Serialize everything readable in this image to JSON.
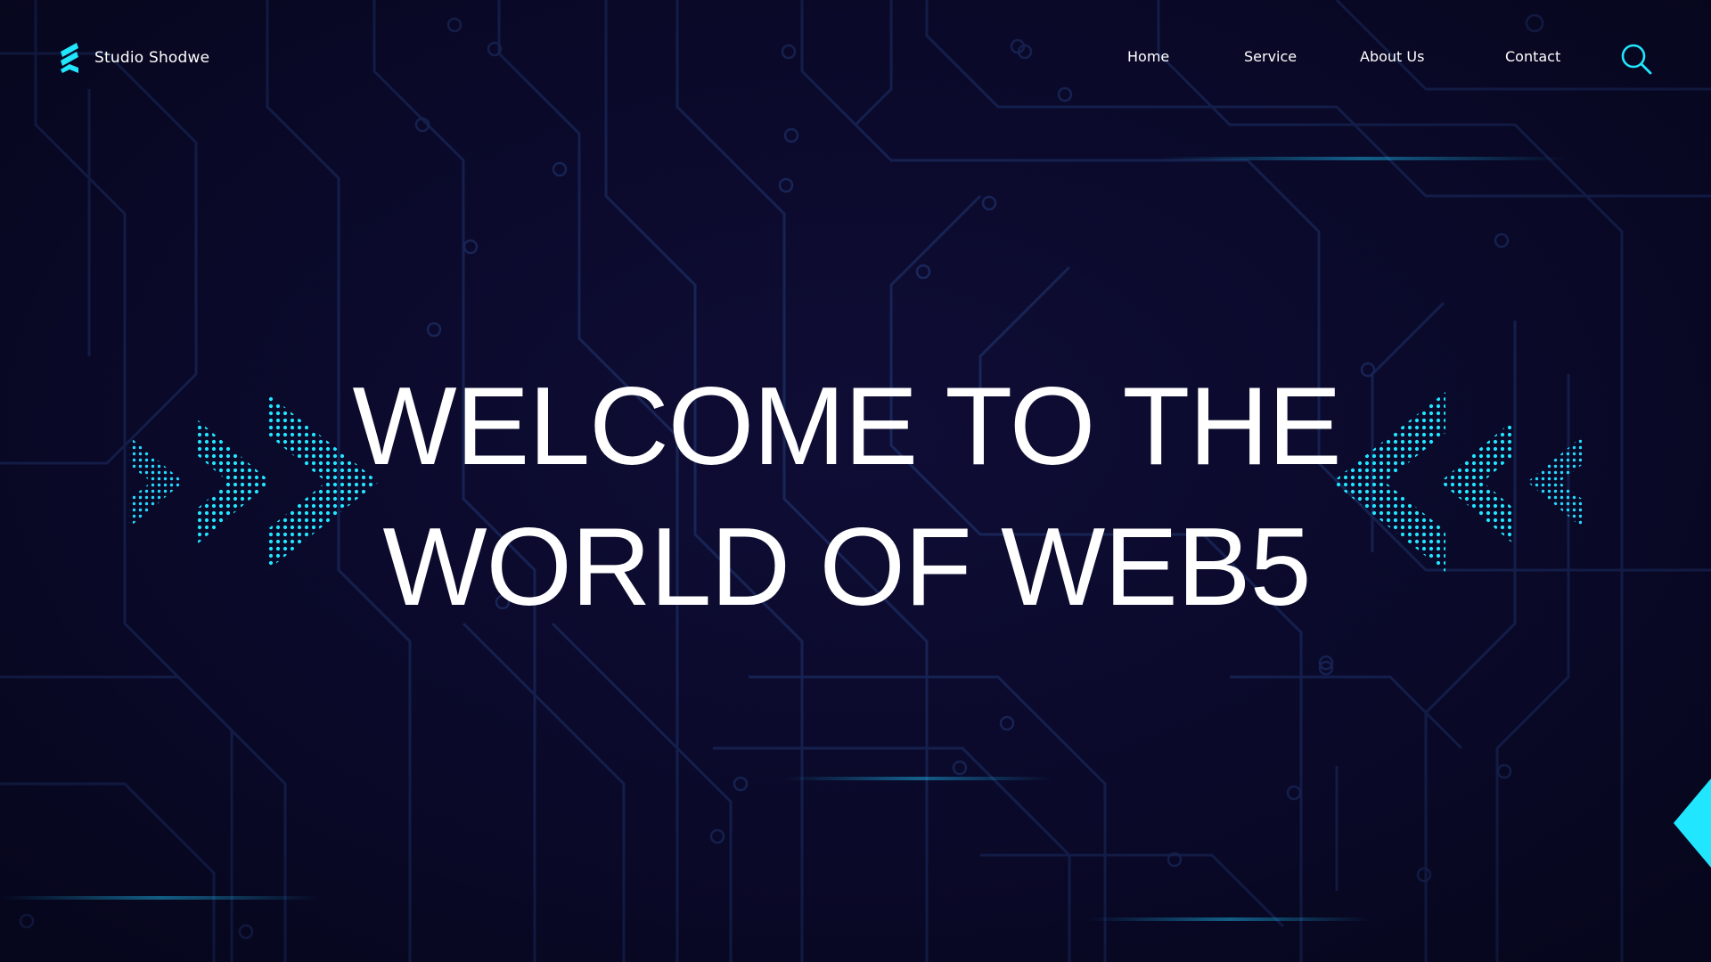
{
  "brand": {
    "name": "Studio Shodwe",
    "logo_icon": "stacked-chevron-logo-icon"
  },
  "nav": {
    "items": [
      {
        "label": "Home"
      },
      {
        "label": "Service"
      },
      {
        "label": "About Us"
      },
      {
        "label": "Contact"
      }
    ],
    "search_icon": "search-icon"
  },
  "hero": {
    "line1": "WELCOME TO THE",
    "line2": "WORLD OF WEB5"
  },
  "theme": {
    "background": "#0b0a2c",
    "accent": "#21e6ff",
    "circuit": "#1a2a5c",
    "text": "#ffffff"
  }
}
